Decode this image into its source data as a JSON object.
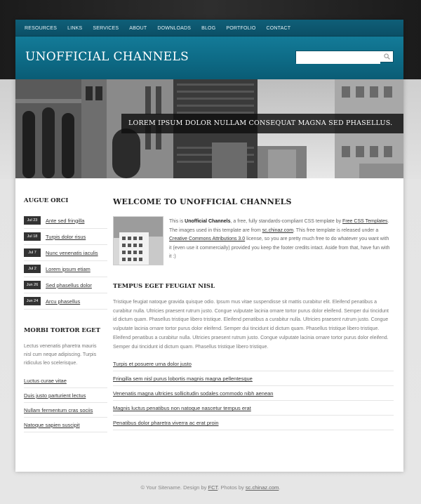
{
  "nav": [
    "RESOURCES",
    "LINKS",
    "SERVICES",
    "ABOUT",
    "DOWNLOADS",
    "BLOG",
    "PORTFOLIO",
    "CONTACT"
  ],
  "header": {
    "title": "UNOFFICIAL CHANNELS",
    "search_value": ""
  },
  "banner": {
    "caption": "LOREM IPSUM DOLOR NULLAM CONSEQUAT MAGNA SED PHASELLUS."
  },
  "sidebar": {
    "news_heading": "AUGUE ORCI",
    "news": [
      {
        "date": "Jul 23",
        "title": "Ante sed fringilla"
      },
      {
        "date": "Jul 18",
        "title": "Turpis dolor risus"
      },
      {
        "date": "Jul 7",
        "title": "Nunc venenatis iaculis"
      },
      {
        "date": "Jul 2",
        "title": "Lorem ipsum etiam"
      },
      {
        "date": "Jun 26",
        "title": "Sed phasellus dolor"
      },
      {
        "date": "Jun 24",
        "title": "Arcu phasellus"
      }
    ],
    "second_heading": "MORBI TORTOR EGET",
    "second_text": "Lectus venenatis pharetra mauris nisl cum neque adipiscing. Turpis ridiculus leo scelerisque.",
    "links": [
      "Luctus curae vitae",
      "Duis justo parturient lectus",
      "Nullam fermentum cras sociis",
      "Natoque sapien suscipit"
    ]
  },
  "main": {
    "heading": "WELCOME TO UNOFFICIAL CHANNELS",
    "intro": {
      "p1": "This is ",
      "name": "Unofficial Channels",
      "p2": ", a free, fully standards-compliant CSS template by ",
      "link1": "Free CSS Templates",
      "p3": ". The images used in this template are from ",
      "link2": "sc.chinaz.com",
      "p4": ". This free template is released under a ",
      "link3": "Creative Commons Attributions 3.0",
      "p5": " license, so you are pretty much free to do whatever you want with it (even use it commercially) provided you keep the footer credits intact. Aside from that, have fun with it :)"
    },
    "sub_heading": "TEMPUS EGET FEUGIAT NISL",
    "body": "Tristique feugiat natoque gravida quisque odio. Ipsum mus vitae suspendisse sit mattis curabitur elit. Eleifend penatibus a curabitur nulla. Ultricies praesent rutrum justo. Congue vulputate lacinia ornare tortor purus dolor eleifend. Semper dui tincidunt id dictum quam. Phasellus tristique libero tristique. Eleifend penatibus a curabitur nulla. Ultricies praesent rutrum justo. Congue vulputate lacinia ornare tortor purus dolor eleifend. Semper dui tincidunt id dictum quam. Phasellus tristique libero tristique. Eleifend penatibus a curabitur nulla. Ultricies praesent rutrum justo. Congue vulputate lacinia ornare tortor purus dolor eleifend. Semper dui tincidunt id dictum quam. Phasellus tristique libero tristique.",
    "links": [
      "Turpis et posuere urna dolor justo",
      "Fringilla sem nisl purus lobortis magnis magna pellentesque",
      "Venenatis magna ultricies sollicitudin sodales commodo nibh aenean",
      "Magnis luctus penatibus non natoque nascetur tempus erat",
      "Penatibus dolor pharetra viverra ac erat proin"
    ]
  },
  "footer": {
    "p1": "© Your Sitename. Design by ",
    "link1": "FCT",
    "p2": ". Photos by ",
    "link2": "sc.chinaz.com",
    "p3": "."
  },
  "colors": {
    "nav_bg": "#0d5c75",
    "masthead": "#0f7190",
    "caption_bg": "#141414"
  },
  "icons": {
    "search": "search-icon"
  }
}
